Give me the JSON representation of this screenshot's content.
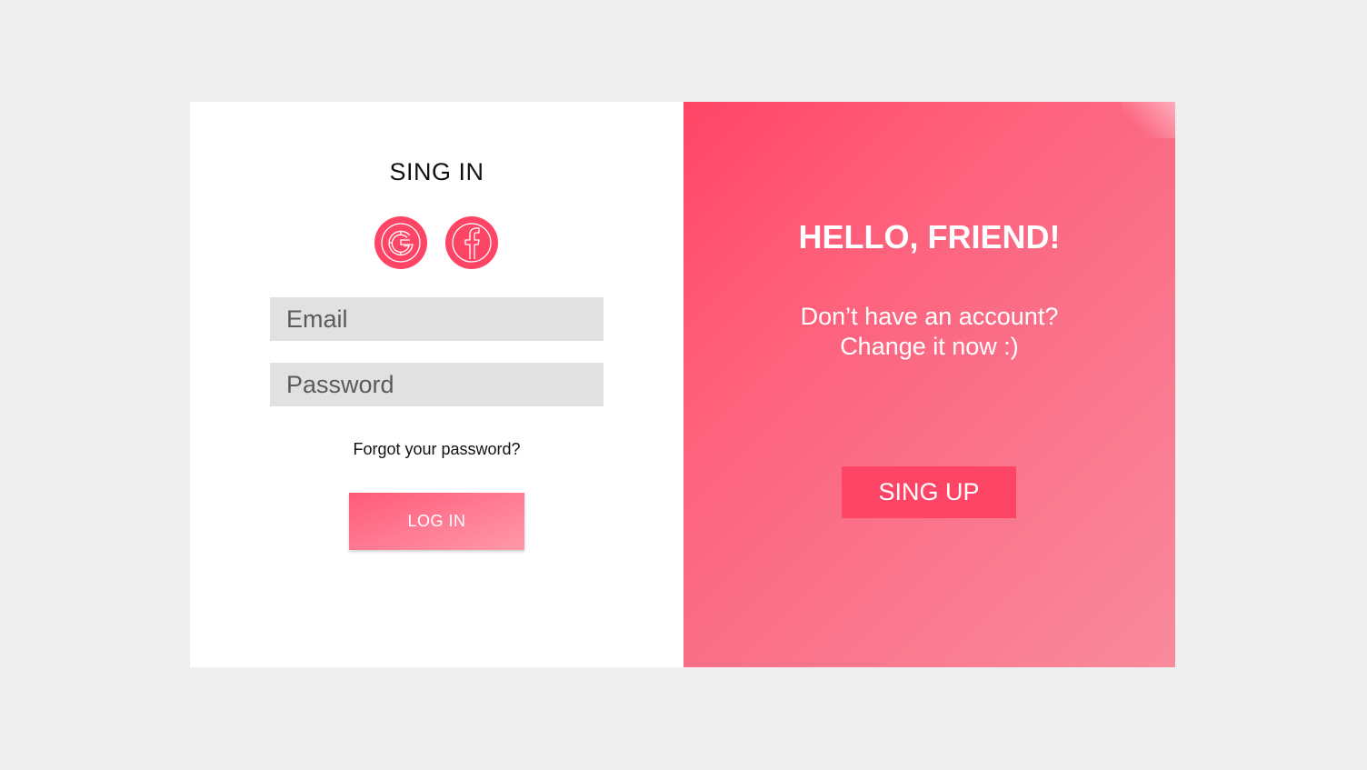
{
  "signin": {
    "title": "SING IN",
    "social": [
      {
        "name": "google",
        "icon": "google-icon"
      },
      {
        "name": "facebook",
        "icon": "facebook-icon"
      }
    ],
    "email_placeholder": "Email",
    "password_placeholder": "Password",
    "forgot_label": "Forgot your password?",
    "login_label": "LOG IN"
  },
  "promo": {
    "title": "HELLO, FRIEND!",
    "line1": "Don’t have an account?",
    "line2": "Change it now :)",
    "signup_label": "SING UP"
  },
  "colors": {
    "accent": "#ff4566",
    "background": "#efefef",
    "input_bg": "#e1e1e1"
  }
}
